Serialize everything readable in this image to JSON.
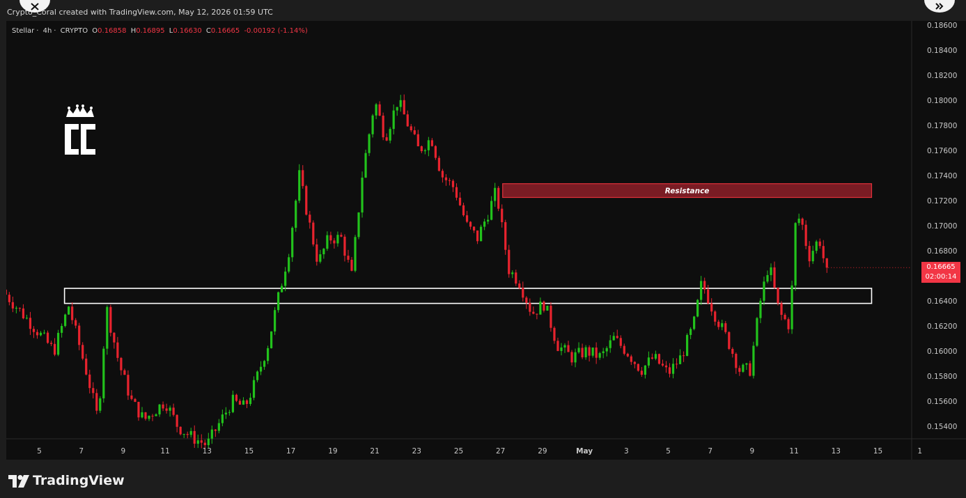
{
  "header": {
    "created_text": "Crypto_Coral created with TradingView.com, May 12, 2026 01:59 UTC"
  },
  "legend": {
    "symbol": "Stellar",
    "interval": "4h",
    "exchange": "CRYPTO",
    "o_label": "O",
    "o_value": "0.16858",
    "h_label": "H",
    "h_value": "0.16895",
    "l_label": "L",
    "l_value": "0.16630",
    "c_label": "C",
    "c_value": "0.16665",
    "change": "-0.00192 (-1.14%)"
  },
  "price_badge": {
    "price": "0.16665",
    "countdown": "02:00:14"
  },
  "footer": {
    "brand": "TradingView"
  },
  "colors": {
    "up": "#22c21c",
    "down": "#e8232e",
    "background": "#0e0e0e",
    "resistance_fill": "#7a1c24",
    "resistance_border": "#e0303a",
    "support_border": "#ffffff"
  },
  "chart_data": {
    "type": "candlestick",
    "symbol": "Stellar",
    "interval": "4h",
    "y_axis": {
      "ticks": [
        "0.18600",
        "0.18400",
        "0.18200",
        "0.18000",
        "0.17800",
        "0.17600",
        "0.17400",
        "0.17200",
        "0.17000",
        "0.16800",
        "0.16400",
        "0.16200",
        "0.16000",
        "0.15800",
        "0.15600",
        "0.15400"
      ],
      "range": [
        0.1525,
        0.1865
      ]
    },
    "x_axis": {
      "ticks": [
        "5",
        "7",
        "9",
        "11",
        "13",
        "15",
        "17",
        "19",
        "21",
        "23",
        "25",
        "27",
        "29",
        "May",
        "3",
        "5",
        "7",
        "9",
        "11",
        "13",
        "15",
        "1"
      ],
      "day_index": [
        5,
        7,
        9,
        11,
        13,
        15,
        17,
        19,
        21,
        23,
        25,
        27,
        29,
        31,
        33,
        35,
        37,
        39,
        41,
        43,
        45,
        47
      ]
    },
    "close_path": [
      [
        3.4,
        0.1645
      ],
      [
        4.6,
        0.1622
      ],
      [
        5.7,
        0.16
      ],
      [
        6.4,
        0.1636
      ],
      [
        7.3,
        0.158
      ],
      [
        7.8,
        0.1545
      ],
      [
        8.2,
        0.1635
      ],
      [
        8.8,
        0.159
      ],
      [
        9.4,
        0.156
      ],
      [
        10.0,
        0.1545
      ],
      [
        11.0,
        0.156
      ],
      [
        11.6,
        0.154
      ],
      [
        12.2,
        0.1532
      ],
      [
        13.0,
        0.1525
      ],
      [
        13.5,
        0.154
      ],
      [
        14.2,
        0.156
      ],
      [
        14.8,
        0.1555
      ],
      [
        15.3,
        0.1575
      ],
      [
        15.9,
        0.1605
      ],
      [
        16.5,
        0.165
      ],
      [
        16.9,
        0.168
      ],
      [
        17.4,
        0.174
      ],
      [
        17.9,
        0.17
      ],
      [
        18.3,
        0.167
      ],
      [
        18.8,
        0.169
      ],
      [
        19.4,
        0.169
      ],
      [
        19.9,
        0.166
      ],
      [
        20.4,
        0.174
      ],
      [
        21.0,
        0.18
      ],
      [
        21.5,
        0.177
      ],
      [
        22.1,
        0.18
      ],
      [
        22.6,
        0.178
      ],
      [
        23.1,
        0.176
      ],
      [
        23.7,
        0.177
      ],
      [
        24.2,
        0.174
      ],
      [
        24.8,
        0.173
      ],
      [
        25.4,
        0.17
      ],
      [
        25.9,
        0.169
      ],
      [
        26.4,
        0.171
      ],
      [
        26.8,
        0.1728
      ],
      [
        27.0,
        0.1705
      ],
      [
        27.4,
        0.1665
      ],
      [
        27.9,
        0.1655
      ],
      [
        28.5,
        0.163
      ],
      [
        29.1,
        0.1638
      ],
      [
        29.7,
        0.1605
      ],
      [
        30.4,
        0.1595
      ],
      [
        31.1,
        0.16
      ],
      [
        31.8,
        0.1595
      ],
      [
        32.4,
        0.161
      ],
      [
        33.0,
        0.16
      ],
      [
        33.7,
        0.1585
      ],
      [
        34.3,
        0.1595
      ],
      [
        35.0,
        0.1582
      ],
      [
        35.6,
        0.1595
      ],
      [
        36.2,
        0.162
      ],
      [
        36.6,
        0.1655
      ],
      [
        37.2,
        0.163
      ],
      [
        37.8,
        0.161
      ],
      [
        38.4,
        0.1585
      ],
      [
        38.9,
        0.1585
      ],
      [
        39.4,
        0.164
      ],
      [
        39.8,
        0.167
      ],
      [
        40.3,
        0.163
      ],
      [
        40.8,
        0.162
      ],
      [
        41.1,
        0.171
      ],
      [
        41.4,
        0.17
      ],
      [
        41.7,
        0.1675
      ],
      [
        42.2,
        0.169
      ],
      [
        42.5,
        0.16665
      ]
    ],
    "zones": [
      {
        "label": "Resistance",
        "from_day": 27.1,
        "to_day": 44.7,
        "low": 0.17225,
        "high": 0.17335
      },
      {
        "label": "",
        "from_day": 6.2,
        "to_day": 44.7,
        "low": 0.1638,
        "high": 0.165
      }
    ],
    "last_price": 0.16665
  }
}
